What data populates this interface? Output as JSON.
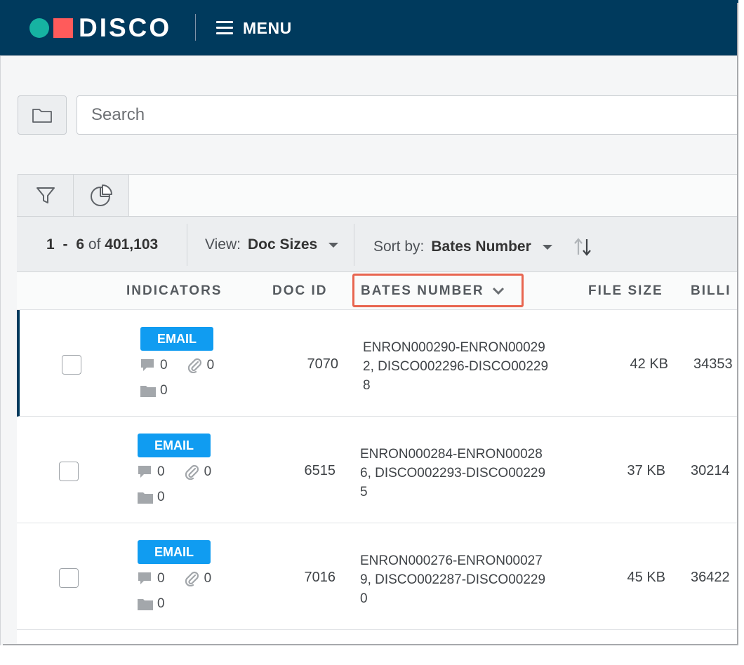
{
  "header": {
    "brand": "DISCO",
    "menu_label": "MENU",
    "brand_colors": {
      "bar": "#003a5d",
      "dot": "#16b3a2",
      "square": "#ff5b5b"
    }
  },
  "search": {
    "placeholder": "Search"
  },
  "tool_tabs": [
    {
      "icon": "filter-icon"
    },
    {
      "icon": "pie-chart-icon"
    }
  ],
  "results": {
    "range_start": "1",
    "range_sep": "-",
    "range_end": "6",
    "of_label": "of",
    "total": "401,103",
    "view_label": "View:",
    "view_value": "Doc Sizes",
    "sort_label": "Sort by:",
    "sort_value": "Bates Number"
  },
  "columns": {
    "indicators": "INDICATORS",
    "doc_id": "DOC ID",
    "bates_number": "BATES NUMBER",
    "file_size": "FILE SIZE",
    "billing": "BILLI"
  },
  "rows": [
    {
      "type": "EMAIL",
      "notes": "0",
      "attachments": "0",
      "folders": "0",
      "doc_id": "7070",
      "bates": "ENRON000290-ENRON000292, DISCO002296-DISCO002298",
      "file_size": "42 KB",
      "billing": "34353",
      "active": true
    },
    {
      "type": "EMAIL",
      "notes": "0",
      "attachments": "0",
      "folders": "0",
      "doc_id": "6515",
      "bates": "ENRON000284-ENRON000286, DISCO002293-DISCO002295",
      "file_size": "37 KB",
      "billing": "30214",
      "active": false
    },
    {
      "type": "EMAIL",
      "notes": "0",
      "attachments": "0",
      "folders": "0",
      "doc_id": "7016",
      "bates": "ENRON000276-ENRON000279, DISCO002287-DISCO002290",
      "file_size": "45 KB",
      "billing": "36422",
      "active": false
    }
  ],
  "accent_colors": {
    "badge": "#109cf1",
    "highlight": "#e8654f"
  }
}
